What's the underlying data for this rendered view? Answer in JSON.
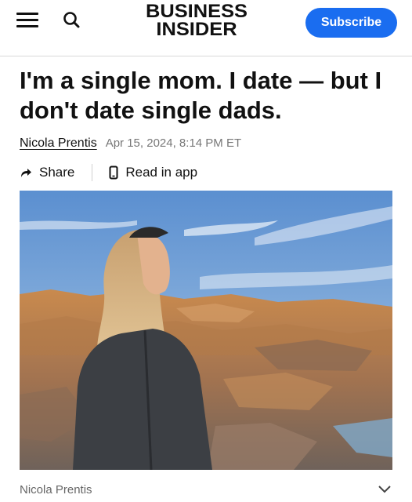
{
  "header": {
    "logo_line1": "BUSINESS",
    "logo_line2": "INSIDER",
    "subscribe_label": "Subscribe",
    "menu_icon": "hamburger-icon",
    "search_icon": "search-icon",
    "accent_color": "#1a6df0"
  },
  "article": {
    "headline": "I'm a single mom. I date — but I don't date single dads.",
    "author": "Nicola Prentis",
    "date": "Apr 15, 2024, 8:14 PM ET",
    "share_label": "Share",
    "read_in_app_label": "Read in app",
    "photo_credit": "Nicola Prentis"
  }
}
